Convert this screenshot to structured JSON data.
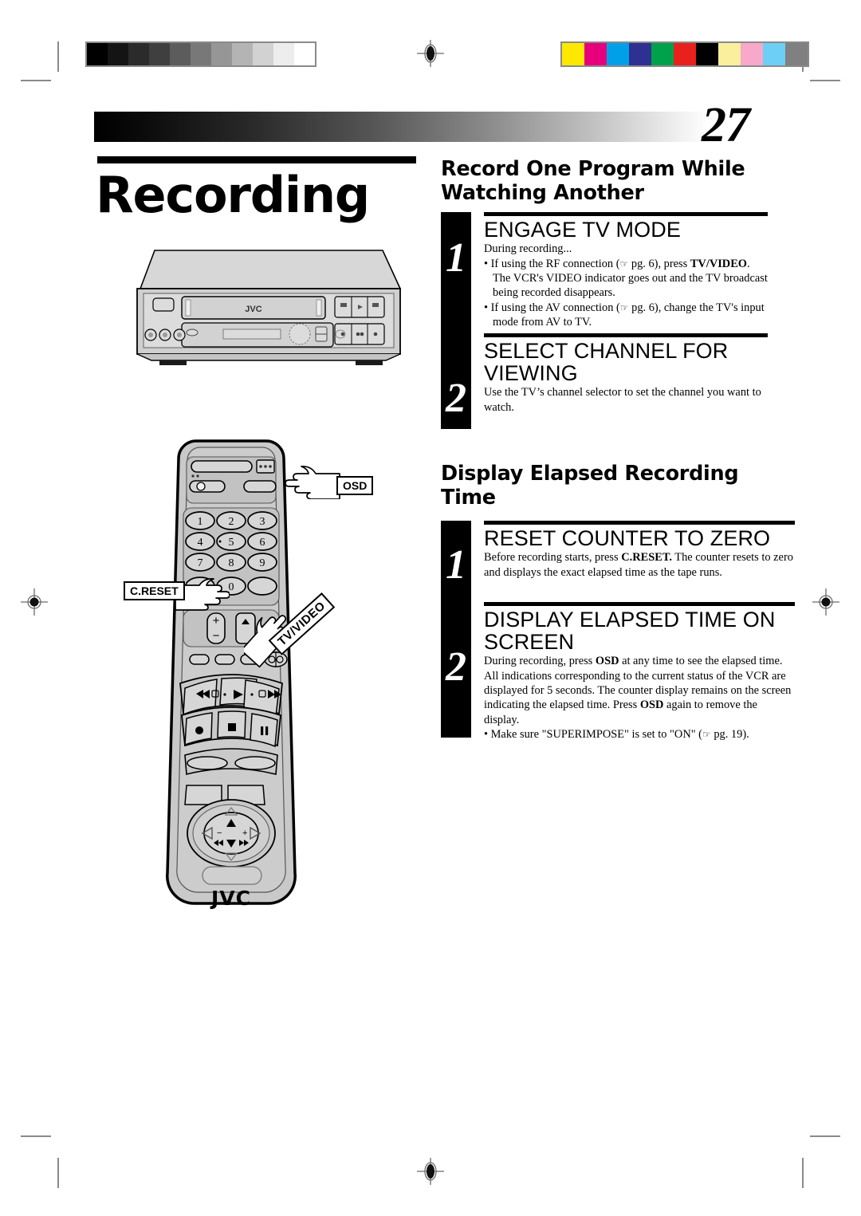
{
  "page": {
    "number": "27",
    "chapter_title": "Recording"
  },
  "printer_marks": {
    "grayscale_swatches": [
      "#000000",
      "#141414",
      "#2b2b2b",
      "#3f3f3f",
      "#5c5c5c",
      "#787878",
      "#969696",
      "#b4b4b4",
      "#d2d2d2",
      "#ededed",
      "#ffffff"
    ],
    "color_swatches": [
      "#ffe800",
      "#e6007e",
      "#00a0e9",
      "#2e3192",
      "#00a14b",
      "#e8211c",
      "#000000",
      "#faef9c",
      "#f7a8cb",
      "#6ecff6",
      "#808080"
    ],
    "registration_icon": "registration-crosshair-icon"
  },
  "sections": [
    {
      "heading": "Record One Program While Watching Another",
      "steps": [
        {
          "number": "1",
          "title": "ENGAGE TV MODE",
          "intro": "During recording...",
          "bullets": [
            "If using the RF connection (☞ pg. 6), press TV/VIDEO. The VCR's VIDEO indicator goes out and the TV broadcast being recorded disappears.",
            "If using the AV connection (☞ pg. 6), change the TV's input mode from AV to TV."
          ]
        },
        {
          "number": "2",
          "title": "SELECT CHANNEL FOR VIEWING",
          "intro": "Use the TV’s channel selector to set the channel you want to watch.",
          "bullets": []
        }
      ]
    },
    {
      "heading": "Display Elapsed Recording Time",
      "steps": [
        {
          "number": "1",
          "title": "RESET COUNTER TO ZERO",
          "intro": "Before recording starts, press C.RESET. The counter resets to zero and displays the exact elapsed time as the tape runs.",
          "bullets": []
        },
        {
          "number": "2",
          "title": "DISPLAY ELAPSED TIME ON SCREEN",
          "intro": "During recording, press OSD at any time to see the elapsed time. All indications corresponding to the current status of the VCR are displayed for 5 seconds. The counter display remains on the screen indicating the elapsed time. Press OSD again to remove the display.",
          "bullets": [
            "Make sure \"SUPERIMPOSE\" is set to \"ON\" (☞ pg. 19)."
          ]
        }
      ]
    }
  ],
  "illustrations": {
    "vcr": {
      "brand_label": "JVC",
      "caption": "vcr-front-panel"
    },
    "remote": {
      "brand_label": "JVC",
      "keypad": [
        "1",
        "2",
        "3",
        "4",
        "5",
        "6",
        "7",
        "8",
        "9",
        "0"
      ],
      "volume_plus": "+",
      "volume_minus": "–",
      "callouts": [
        {
          "label": "OSD",
          "target": "osd-button"
        },
        {
          "label": "C.RESET",
          "target": "c-reset-button"
        },
        {
          "label": "TV/VIDEO",
          "target": "tv-video-button"
        }
      ]
    }
  }
}
